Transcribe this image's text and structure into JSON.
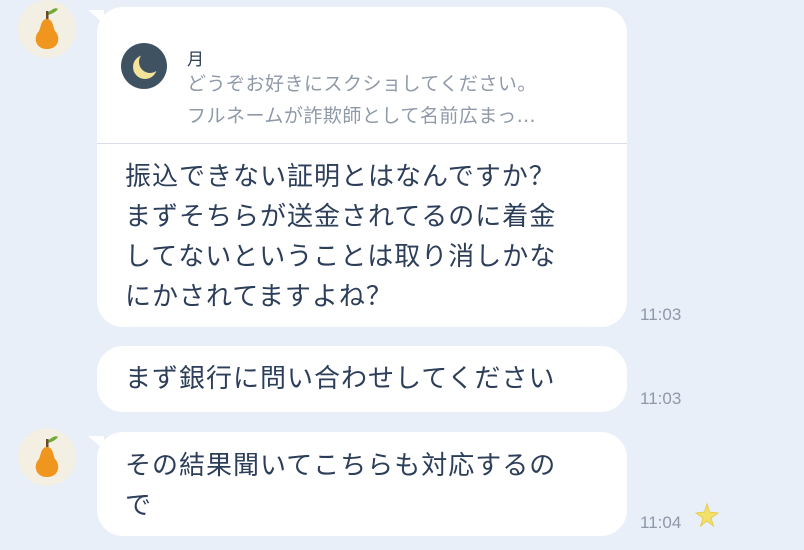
{
  "quote": {
    "name": "月",
    "line1": "どうぞお好きにスクショしてください。",
    "line2": "フルネームが詐欺師として名前広まっ…"
  },
  "messages": [
    {
      "text": "振込できない証明とはなんですか？\nまずそちらが送金されてるのに着金\nしてないということは取り消しかな\nにかされてますよね？",
      "time": "11:03"
    },
    {
      "text": "まず銀行に問い合わせしてください",
      "time": "11:03"
    },
    {
      "text": "その結果聞いてこちらも対応するの\nで",
      "time": "11:04"
    }
  ],
  "icons": {
    "avatar": "pear-icon",
    "quote_avatar": "moon-icon",
    "reaction": "sparkle-star-icon"
  },
  "colors": {
    "background": "#e8eff9",
    "bubble": "#ffffff",
    "text": "#2c3e59",
    "pear": "#f0951d",
    "star": "#f2e06a"
  }
}
